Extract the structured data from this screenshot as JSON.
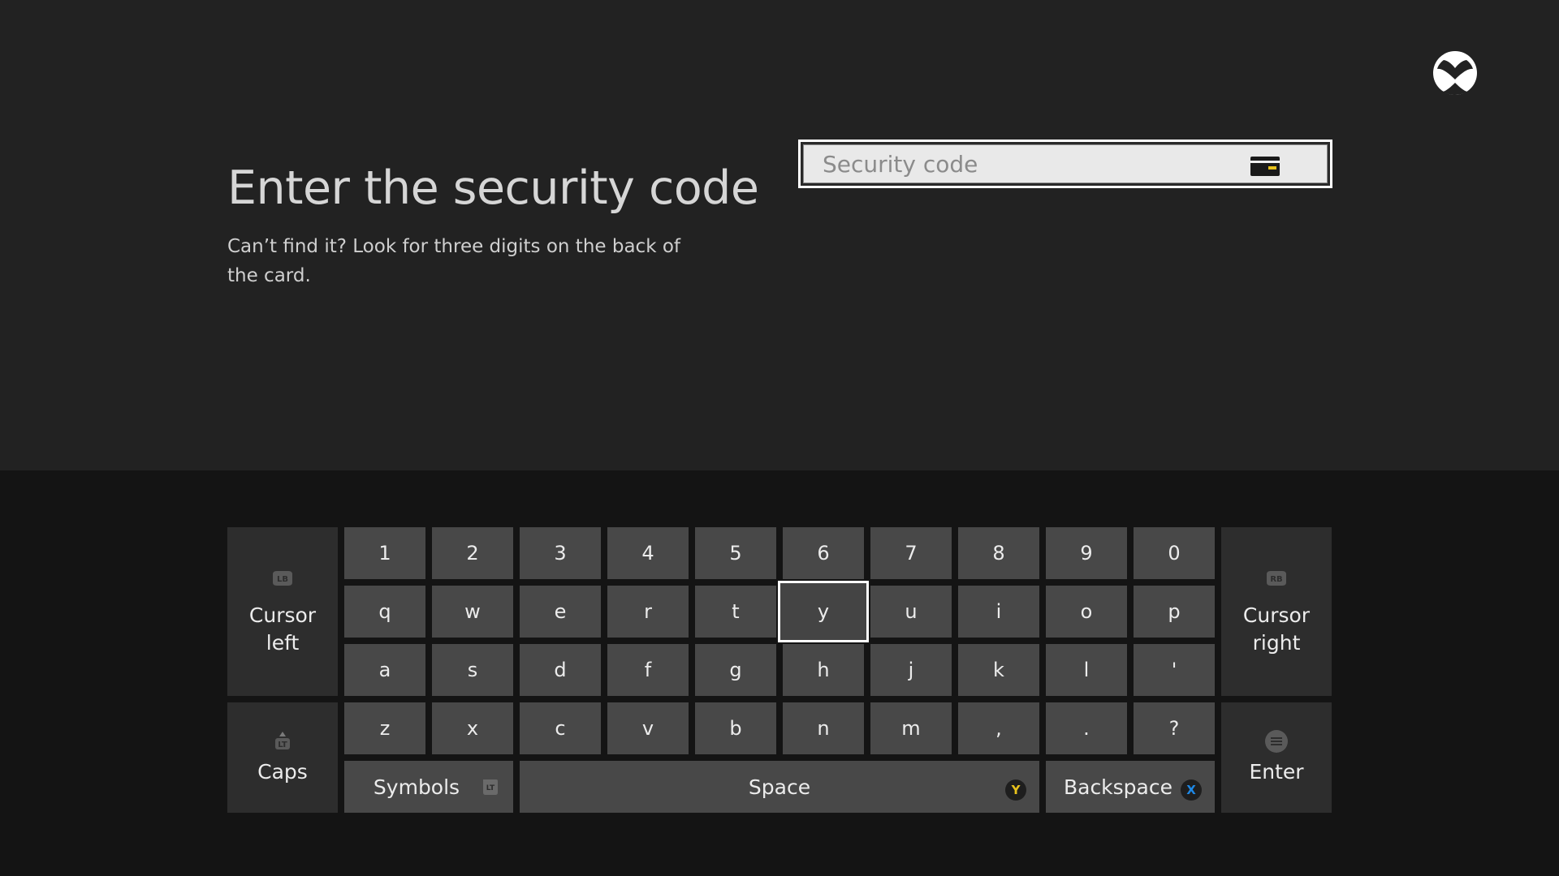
{
  "page": {
    "title": "Enter the security code",
    "hint": "Can’t find it? Look for three digits on the back of the card."
  },
  "security_code": {
    "placeholder": "Security code",
    "value": "",
    "icon": "credit-card-icon"
  },
  "logo": {
    "icon": "xbox-logo-icon"
  },
  "keyboard": {
    "focused_key": "y",
    "rows": [
      [
        "1",
        "2",
        "3",
        "4",
        "5",
        "6",
        "7",
        "8",
        "9",
        "0"
      ],
      [
        "q",
        "w",
        "e",
        "r",
        "t",
        "y",
        "u",
        "i",
        "o",
        "p"
      ],
      [
        "a",
        "s",
        "d",
        "f",
        "g",
        "h",
        "j",
        "k",
        "l",
        "'"
      ],
      [
        "z",
        "x",
        "c",
        "v",
        "b",
        "n",
        "m",
        ",",
        ".",
        "?"
      ]
    ],
    "cursor_left": {
      "label_line1": "Cursor",
      "label_line2": "left",
      "button": "LB"
    },
    "cursor_right": {
      "label_line1": "Cursor",
      "label_line2": "right",
      "button": "RB"
    },
    "caps": {
      "label": "Caps",
      "button": "LT"
    },
    "enter": {
      "label": "Enter",
      "icon": "menu-button-icon"
    },
    "symbols": {
      "label": "Symbols",
      "button": "LT"
    },
    "space": {
      "label": "Space",
      "button": "Y",
      "button_color": "#e8c21c"
    },
    "backspace": {
      "label": "Backspace",
      "button": "X",
      "button_color": "#1e88e5"
    }
  }
}
